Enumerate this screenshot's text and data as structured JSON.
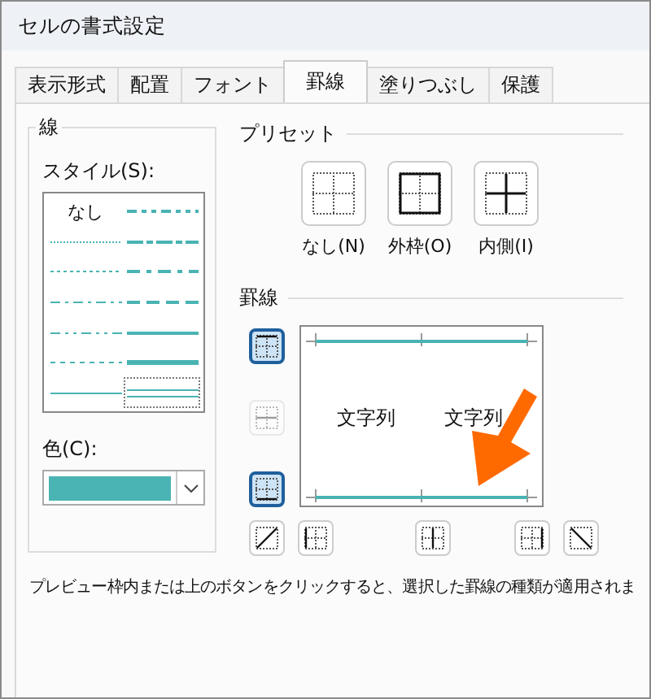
{
  "window": {
    "title": "セルの書式設定"
  },
  "tabs": [
    {
      "label": "表示形式",
      "selected": false
    },
    {
      "label": "配置",
      "selected": false
    },
    {
      "label": "フォント",
      "selected": false
    },
    {
      "label": "罫線",
      "selected": true
    },
    {
      "label": "塗りつぶし",
      "selected": false
    },
    {
      "label": "保護",
      "selected": false
    }
  ],
  "line_group": {
    "title": "線",
    "style_label": "スタイル(S):",
    "styles": [
      {
        "kind": "none",
        "label": "なし",
        "selected": false
      },
      {
        "kind": "hair",
        "selected": false
      },
      {
        "kind": "dotted",
        "selected": false
      },
      {
        "kind": "dash_dot",
        "selected": false
      },
      {
        "kind": "dash_dot_dot",
        "selected": false
      },
      {
        "kind": "dashed",
        "selected": false
      },
      {
        "kind": "thin",
        "selected": false
      },
      {
        "kind": "medium_dash_dot_dot",
        "selected": false
      },
      {
        "kind": "slant_dash_dot",
        "selected": false
      },
      {
        "kind": "medium_dash_dot",
        "selected": false
      },
      {
        "kind": "medium_dashed",
        "selected": false
      },
      {
        "kind": "medium",
        "selected": false
      },
      {
        "kind": "thick",
        "selected": false
      },
      {
        "kind": "double",
        "selected": true
      }
    ],
    "color_label": "色(C):",
    "color": "#4ab3b3"
  },
  "presets": {
    "title": "プリセット",
    "buttons": [
      {
        "kind": "none",
        "label": "なし(N)"
      },
      {
        "kind": "outline",
        "label": "外枠(O)"
      },
      {
        "kind": "inside",
        "label": "内側(I)"
      }
    ]
  },
  "borders": {
    "title": "罫線",
    "side_buttons": [
      {
        "kind": "top",
        "selected": true,
        "disabled": false
      },
      {
        "kind": "middle",
        "selected": false,
        "disabled": true
      },
      {
        "kind": "bottom",
        "selected": true,
        "disabled": false
      }
    ],
    "bottom_buttons": [
      {
        "kind": "diag_up",
        "selected": false,
        "disabled": false
      },
      {
        "kind": "left",
        "selected": false,
        "disabled": false
      },
      {
        "kind": "center",
        "selected": false,
        "disabled": false
      },
      {
        "kind": "right",
        "selected": false,
        "disabled": false
      },
      {
        "kind": "diag_down",
        "selected": false,
        "disabled": false
      }
    ],
    "preview": {
      "texts": [
        "文字列",
        "文字列"
      ],
      "top": true,
      "bottom": true
    }
  },
  "hint": "プレビュー枠内または上のボタンをクリックすると、選択した罫線の種類が適用されま"
}
